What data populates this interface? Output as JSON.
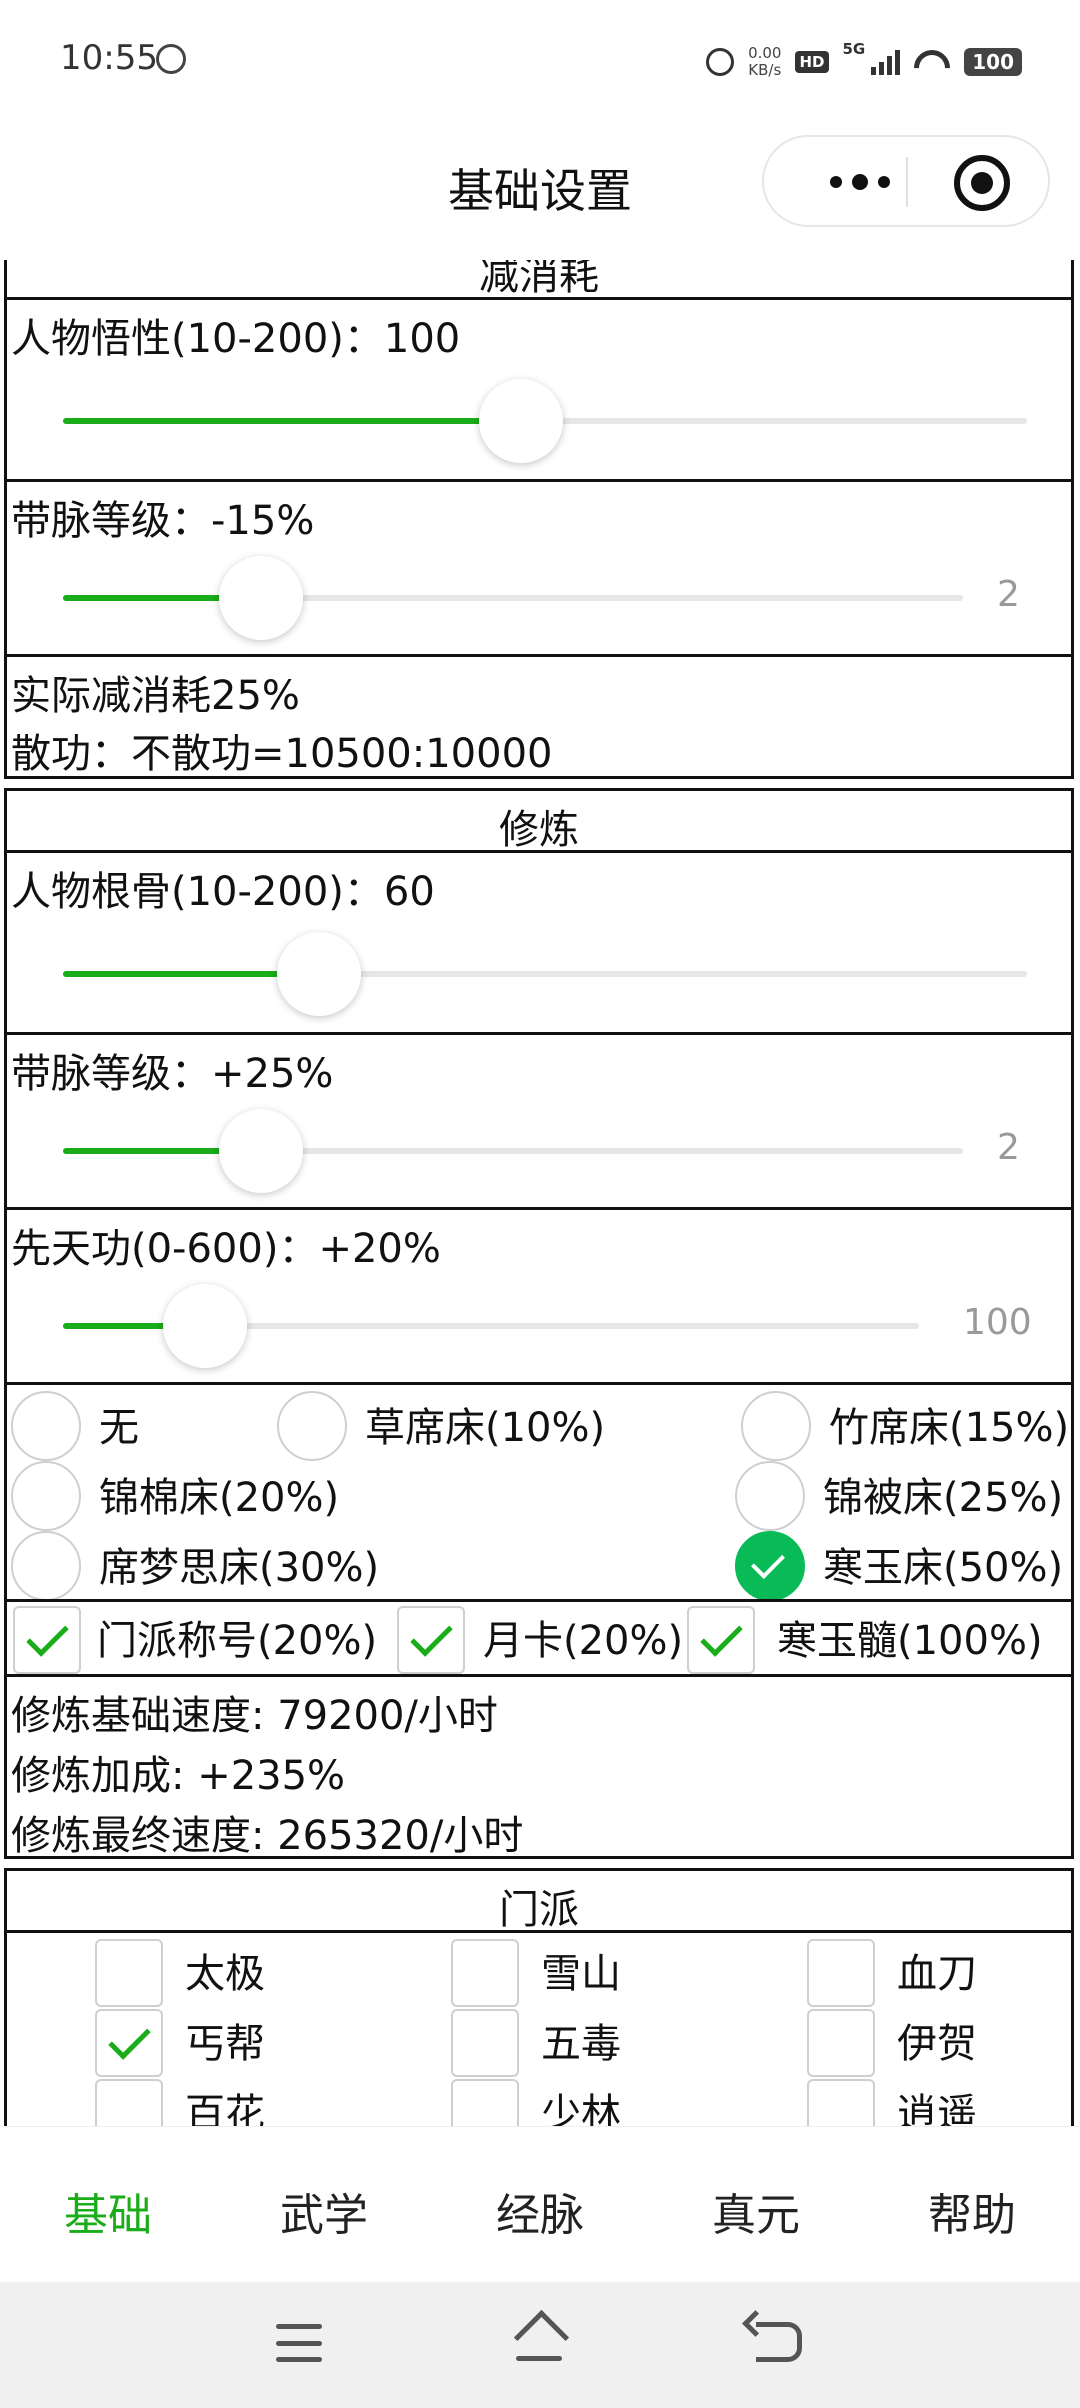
{
  "status_bar": {
    "time": "10:55",
    "net_speed_value": "0.00",
    "net_speed_unit": "KB/s",
    "hd_label": "HD",
    "network_label": "5G",
    "battery": "100"
  },
  "nav": {
    "title": "基础设置"
  },
  "section_reduce": {
    "title": "减消耗",
    "wuxing_label": "人物悟性(10-200)：100",
    "wuxing_value": 100,
    "wuxing_range": [
      10,
      200
    ],
    "daimai1_label": "带脉等级：-15%",
    "daimai1_display": "2",
    "summary_line1": "实际减消耗25%",
    "summary_line2": "散功：不散功=10500:10000"
  },
  "section_train": {
    "title": "修炼",
    "gengu_label": "人物根骨(10-200)：60",
    "gengu_value": 60,
    "gengu_range": [
      10,
      200
    ],
    "daimai2_label": "带脉等级：+25%",
    "daimai2_display": "2",
    "xiantian_label": "先天功(0-600)：+20%",
    "xiantian_display": "100",
    "beds": [
      {
        "label": "无",
        "checked": false
      },
      {
        "label": "草席床(10%)",
        "checked": false
      },
      {
        "label": "竹席床(15%)",
        "checked": false
      },
      {
        "label": "锦棉床(20%)",
        "checked": false
      },
      {
        "label": "锦被床(25%)",
        "checked": false
      },
      {
        "label": "席梦思床(30%)",
        "checked": false
      },
      {
        "label": "寒玉床(50%)",
        "checked": true
      }
    ],
    "bonuses": [
      {
        "label": "门派称号(20%)",
        "checked": true
      },
      {
        "label": "月卡(20%)",
        "checked": true
      },
      {
        "label": "寒玉髓(100%)",
        "checked": true
      }
    ],
    "result_base": "修炼基础速度: 79200/小时",
    "result_bonus": "修炼加成: +235%",
    "result_final": "修炼最终速度: 265320/小时"
  },
  "section_sect": {
    "title": "门派",
    "sects": [
      {
        "label": "太极",
        "checked": false
      },
      {
        "label": "雪山",
        "checked": false
      },
      {
        "label": "血刀",
        "checked": false
      },
      {
        "label": "丐帮",
        "checked": true
      },
      {
        "label": "五毒",
        "checked": false
      },
      {
        "label": "伊贺",
        "checked": false
      },
      {
        "label": "百花",
        "checked": false
      },
      {
        "label": "少林",
        "checked": false
      },
      {
        "label": "逍遥",
        "checked": false
      }
    ]
  },
  "tabs": [
    "基础",
    "武学",
    "经脉",
    "真元",
    "帮助"
  ],
  "colors": {
    "accent_green": "#1aad19",
    "radio_green": "#09bb57"
  }
}
